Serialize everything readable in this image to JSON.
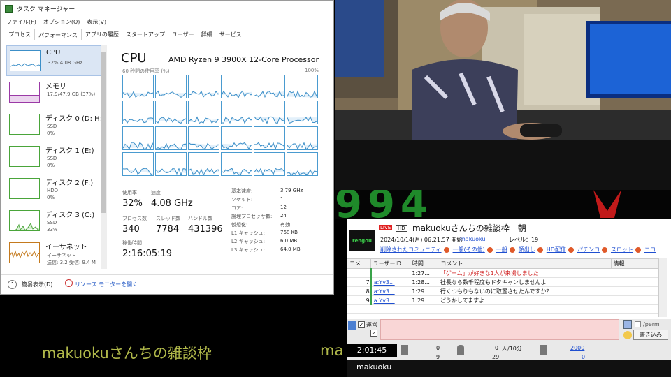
{
  "taskmanager": {
    "title": "タスク マネージャー",
    "menu": [
      "ファイル(F)",
      "オプション(O)",
      "表示(V)"
    ],
    "tabs": [
      "プロセス",
      "パフォーマンス",
      "アプリの履歴",
      "スタートアップ",
      "ユーザー",
      "詳細",
      "サービス"
    ],
    "active_tab": "パフォーマンス",
    "resources": [
      {
        "name": "CPU",
        "line2": "32%  4.08 GHz",
        "line3": "",
        "color": "#3c8fc8"
      },
      {
        "name": "メモリ",
        "line2": "17.9/47.9 GB (37%)",
        "line3": "",
        "color": "#9b3aa6"
      },
      {
        "name": "ディスク 0 (D: H:)",
        "line2": "SSD",
        "line3": "0%",
        "color": "#4aa53a"
      },
      {
        "name": "ディスク 1 (E:)",
        "line2": "SSD",
        "line3": "0%",
        "color": "#4aa53a"
      },
      {
        "name": "ディスク 2 (F:)",
        "line2": "HDD",
        "line3": "0%",
        "color": "#4aa53a"
      },
      {
        "name": "ディスク 3 (C:)",
        "line2": "SSD",
        "line3": "33%",
        "color": "#4aa53a"
      },
      {
        "name": "イーサネット",
        "line2": "イーサネット",
        "line3": "送信: 3.2  受信: 9.4 M",
        "color": "#c47a1e"
      }
    ],
    "cpu": {
      "title": "CPU",
      "model": "AMD Ryzen 9 3900X 12-Core Processor",
      "util_label": "60 秒間の使用率 (%)",
      "util_max": "100%",
      "stats": {
        "usage_label": "使用率",
        "usage": "32%",
        "speed_label": "速度",
        "speed": "4.08 GHz",
        "proc_label": "プロセス数",
        "proc": "340",
        "thread_label": "スレッド数",
        "thread": "7784",
        "handle_label": "ハンドル数",
        "handle": "431396",
        "uptime_label": "稼働時間",
        "uptime": "2:16:05:19"
      },
      "specs": [
        {
          "k": "基本速度:",
          "v": "3.79 GHz"
        },
        {
          "k": "ソケット:",
          "v": "1"
        },
        {
          "k": "コア:",
          "v": "12"
        },
        {
          "k": "論理プロセッサ数:",
          "v": "24"
        },
        {
          "k": "仮想化:",
          "v": "有効"
        },
        {
          "k": "L1 キャッシュ:",
          "v": "768 KB"
        },
        {
          "k": "L2 キャッシュ:",
          "v": "6.0 MB"
        },
        {
          "k": "L3 キャッシュ:",
          "v": "64.0 MB"
        }
      ]
    },
    "footer": {
      "simple": "簡易表示(D)",
      "monitor": "リソース モニターを開く"
    }
  },
  "stream": {
    "banner_text": "994"
  },
  "viewer": {
    "live": "LIVE",
    "hd": "HD",
    "logo": "rengou",
    "title": "makuokuさんちの雑談枠　朝",
    "started": "2024/10/14(月) 06:21:57 開始",
    "owner": "makuoku",
    "level": "レベル：19",
    "categories": [
      "削除されたコミュニティ",
      "一般(その他)",
      "一般",
      "顔出し",
      "HD配信",
      "パチンコ",
      "スロット",
      "ニコ"
    ],
    "columns": [
      "コメ...",
      "ユーザーID",
      "時間",
      "コメント",
      "情報"
    ],
    "rows": [
      {
        "no": "",
        "user": "",
        "time": "1:27...",
        "comment": "「ゲーム」が好きな1人が来場しました",
        "info": "運"
      },
      {
        "no": "7",
        "user": "a:Yv3...",
        "time": "1:28...",
        "comment": "社長なら数千程度もドタキャンしませんよ",
        "info": ""
      },
      {
        "no": "8",
        "user": "a:Yv3...",
        "time": "1:29...",
        "comment": "行くつもりもないのに取置させたんですか？",
        "info": ""
      },
      {
        "no": "9",
        "user": "a:Yv3...",
        "time": "1:29...",
        "comment": "どうかしてますよ",
        "info": ""
      }
    ],
    "operator_label": "運営",
    "anon_label": "184",
    "perm": "/perm",
    "post_button": "書き込み",
    "time": "2:01:45",
    "counts": {
      "a": "0",
      "b": "9",
      "visitors": "0",
      "per10": "人/10分",
      "c": "29",
      "ad": "2000",
      "gift": "0"
    },
    "channel": "makuoku"
  },
  "overlay": {
    "left": "makuokuさんちの雑談枠",
    "right": "ma"
  }
}
